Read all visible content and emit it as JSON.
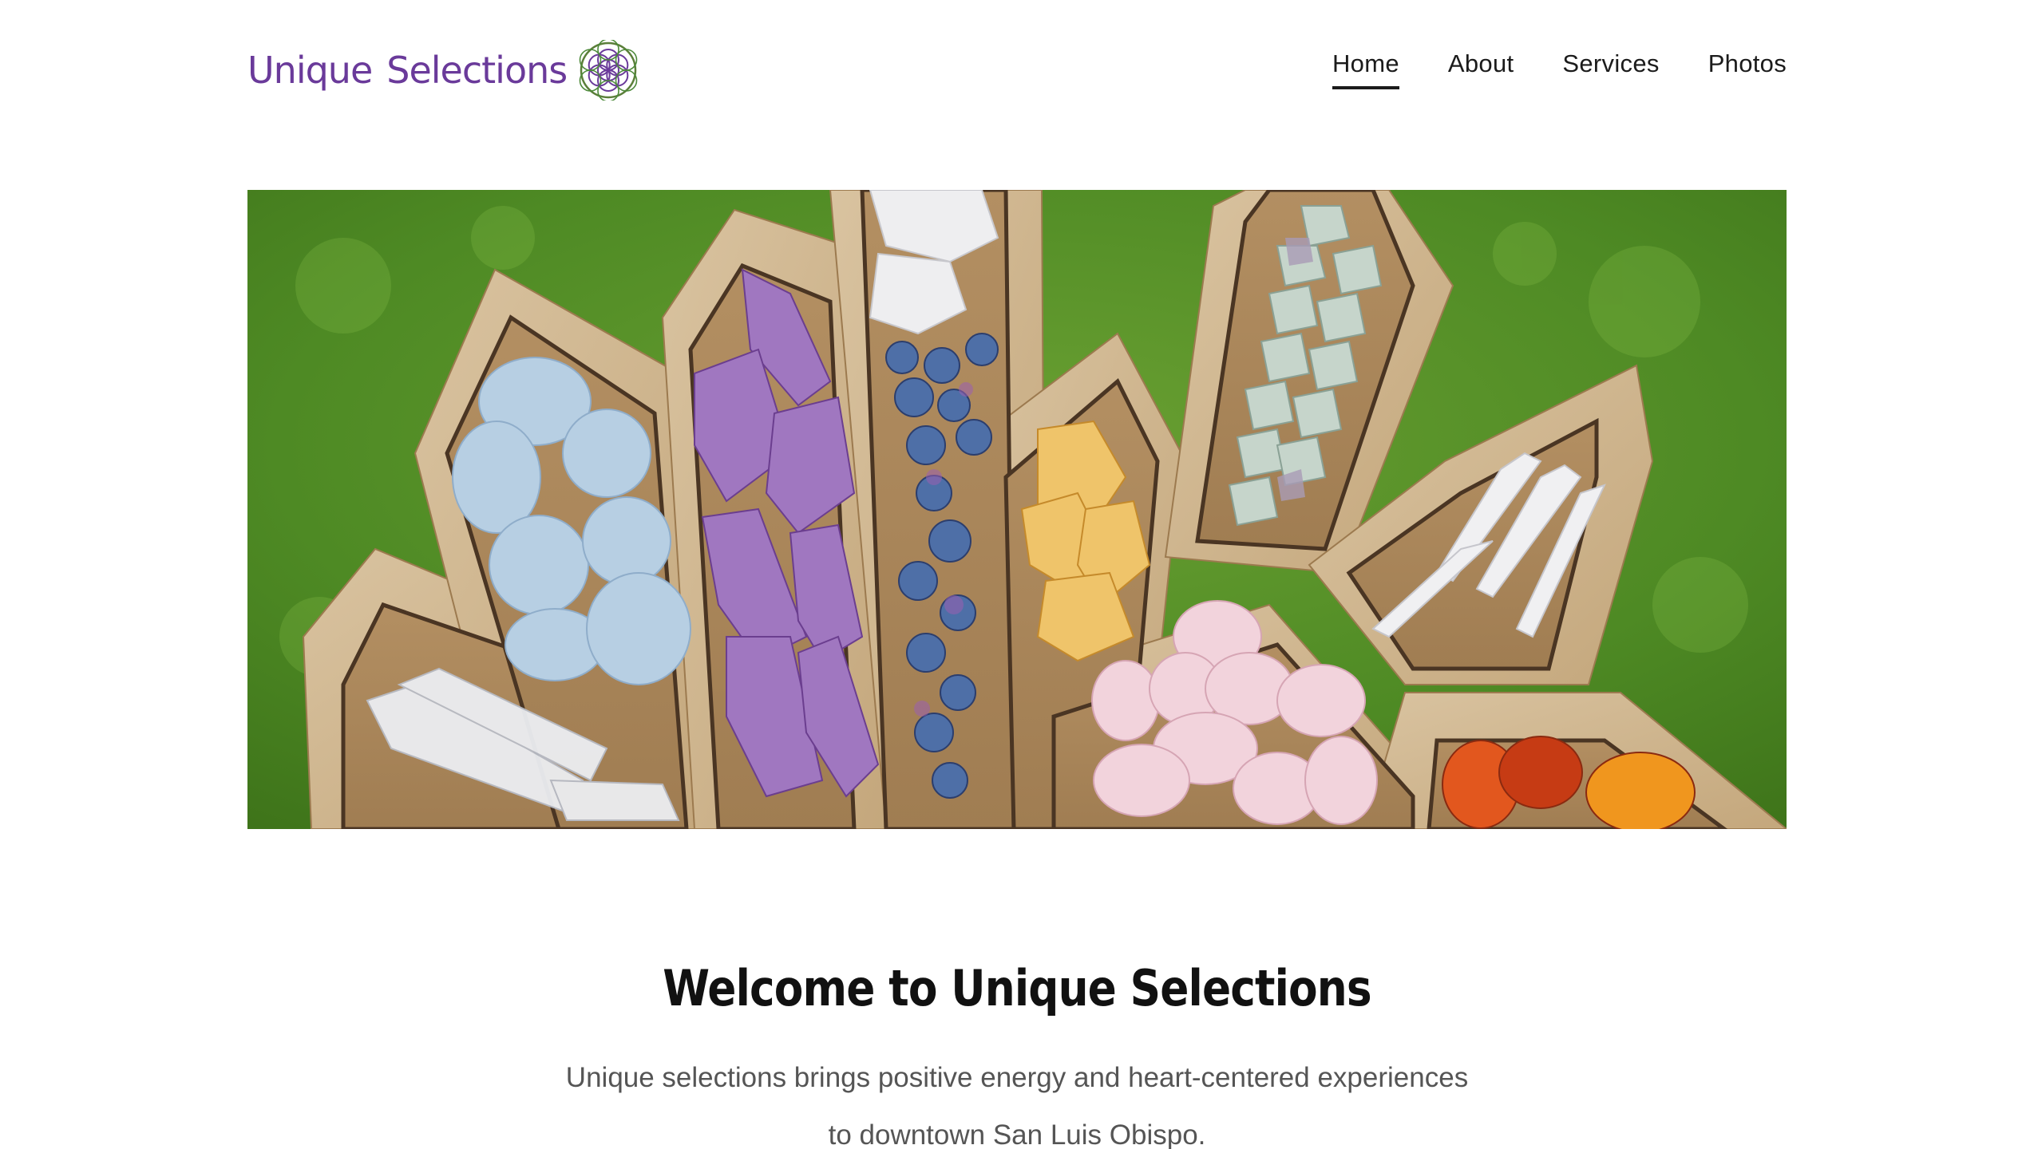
{
  "header": {
    "logo": {
      "text_part1": "Unique",
      "text_part2": "Selections",
      "mark_icon": "flower-of-life-icon",
      "color": "#6a3a9a"
    },
    "nav": [
      {
        "label": "Home",
        "active": true
      },
      {
        "label": "About",
        "active": false
      },
      {
        "label": "Services",
        "active": false
      },
      {
        "label": "Photos",
        "active": false
      }
    ]
  },
  "hero": {
    "subject": "wooden crystal tray on moss"
  },
  "welcome": {
    "title": "Welcome to Unique Selections",
    "line1": "Unique selections brings positive energy and heart-centered experiences",
    "line2": "to downtown San Luis Obispo."
  }
}
